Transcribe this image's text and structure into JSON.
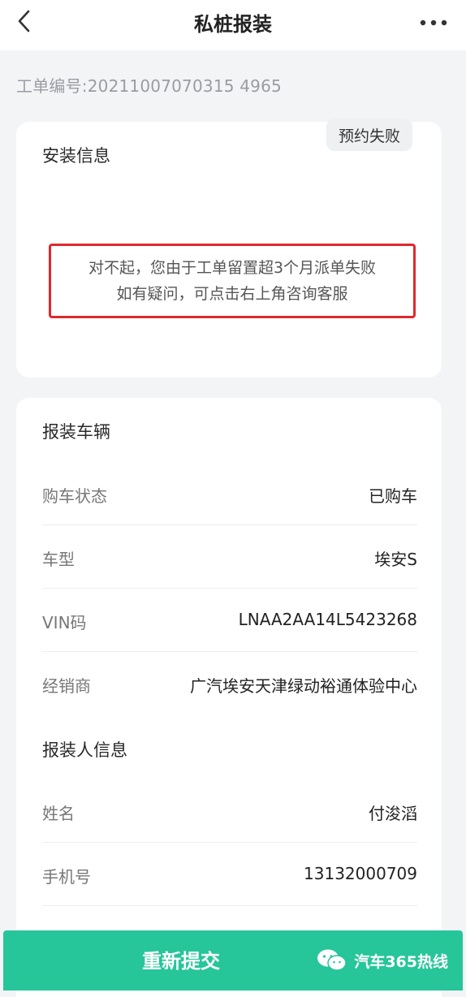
{
  "header": {
    "title": "私桩报装",
    "back_icon": "chevron-left-icon",
    "more_icon": "more-icon"
  },
  "order_number": "工单编号:20211007070315 4965",
  "install_card": {
    "title": "安装信息",
    "status_badge": "预约失败",
    "notice_line1": "对不起，您由于工单留置超3个月派单失败",
    "notice_line2": "如有疑问，可点击右上角咨询客服"
  },
  "vehicle_section": {
    "title": "报装车辆",
    "rows": [
      {
        "label": "购车状态",
        "value": "已购车"
      },
      {
        "label": "车型",
        "value": "埃安S"
      },
      {
        "label": "VIN码",
        "value": "LNAA2AA14L5423268"
      },
      {
        "label": "经销商",
        "value": "广汽埃安天津绿动裕通体验中心"
      }
    ]
  },
  "applicant_section": {
    "title": "报装人信息",
    "rows": [
      {
        "label": "姓名",
        "value": "付浚滔"
      },
      {
        "label": "手机号",
        "value": "13132000709"
      }
    ]
  },
  "footer": {
    "resubmit_label": "重新提交",
    "watermark_text": "汽车365热线",
    "watermark_icon": "wechat-icon"
  },
  "colors": {
    "accent": "#27c59a",
    "alert_border": "#e0282d",
    "page_bg": "#f3f4f6"
  }
}
